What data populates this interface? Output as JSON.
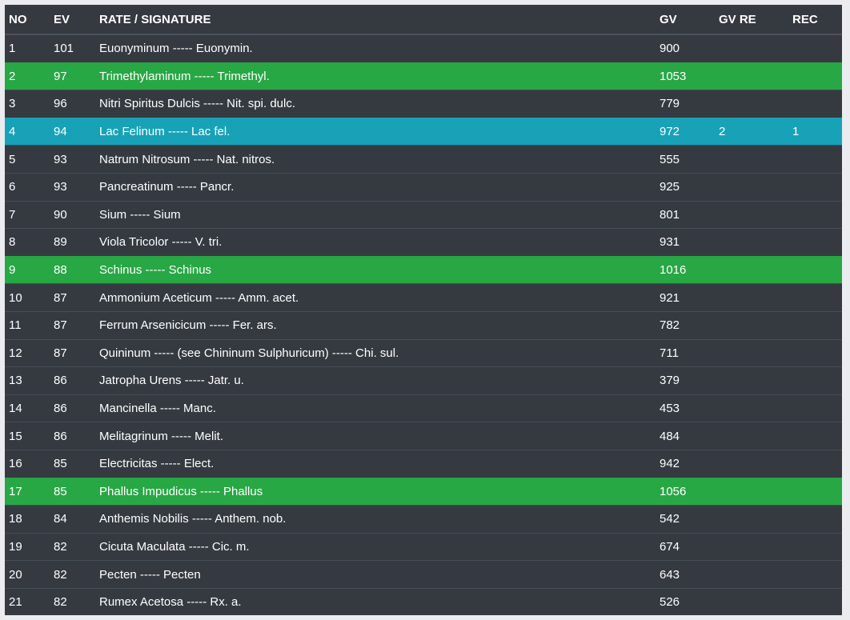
{
  "colors": {
    "background": "#343a40",
    "highlight_green": "#28a745",
    "highlight_cyan": "#17a2b8"
  },
  "table": {
    "headers": [
      "NO",
      "EV",
      "RATE / SIGNATURE",
      "GV",
      "GV RE",
      "REC"
    ],
    "rows": [
      {
        "no": "1",
        "ev": "101",
        "name": "Euonyminum ----- Euonymin.",
        "gv": "900",
        "gv_re": "",
        "rec": "",
        "highlight": ""
      },
      {
        "no": "2",
        "ev": "97",
        "name": "Trimethylaminum ----- Trimethyl.",
        "gv": "1053",
        "gv_re": "",
        "rec": "",
        "highlight": "green"
      },
      {
        "no": "3",
        "ev": "96",
        "name": "Nitri Spiritus Dulcis ----- Nit. spi. dulc.",
        "gv": "779",
        "gv_re": "",
        "rec": "",
        "highlight": ""
      },
      {
        "no": "4",
        "ev": "94",
        "name": "Lac Felinum ----- Lac fel.",
        "gv": "972",
        "gv_re": "2",
        "rec": "1",
        "highlight": "cyan"
      },
      {
        "no": "5",
        "ev": "93",
        "name": "Natrum Nitrosum ----- Nat. nitros.",
        "gv": "555",
        "gv_re": "",
        "rec": "",
        "highlight": ""
      },
      {
        "no": "6",
        "ev": "93",
        "name": "Pancreatinum ----- Pancr.",
        "gv": "925",
        "gv_re": "",
        "rec": "",
        "highlight": ""
      },
      {
        "no": "7",
        "ev": "90",
        "name": "Sium ----- Sium",
        "gv": "801",
        "gv_re": "",
        "rec": "",
        "highlight": ""
      },
      {
        "no": "8",
        "ev": "89",
        "name": "Viola Tricolor ----- V. tri.",
        "gv": "931",
        "gv_re": "",
        "rec": "",
        "highlight": ""
      },
      {
        "no": "9",
        "ev": "88",
        "name": "Schinus ----- Schinus",
        "gv": "1016",
        "gv_re": "",
        "rec": "",
        "highlight": "green"
      },
      {
        "no": "10",
        "ev": "87",
        "name": "Ammonium Aceticum ----- Amm. acet.",
        "gv": "921",
        "gv_re": "",
        "rec": "",
        "highlight": ""
      },
      {
        "no": "11",
        "ev": "87",
        "name": "Ferrum Arsenicicum ----- Fer. ars.",
        "gv": "782",
        "gv_re": "",
        "rec": "",
        "highlight": ""
      },
      {
        "no": "12",
        "ev": "87",
        "name": "Quininum ----- (see Chininum Sulphuricum) ----- Chi. sul.",
        "gv": "711",
        "gv_re": "",
        "rec": "",
        "highlight": ""
      },
      {
        "no": "13",
        "ev": "86",
        "name": "Jatropha Urens ----- Jatr. u.",
        "gv": "379",
        "gv_re": "",
        "rec": "",
        "highlight": ""
      },
      {
        "no": "14",
        "ev": "86",
        "name": "Mancinella ----- Manc.",
        "gv": "453",
        "gv_re": "",
        "rec": "",
        "highlight": ""
      },
      {
        "no": "15",
        "ev": "86",
        "name": "Melitagrinum ----- Melit.",
        "gv": "484",
        "gv_re": "",
        "rec": "",
        "highlight": ""
      },
      {
        "no": "16",
        "ev": "85",
        "name": "Electricitas ----- Elect.",
        "gv": "942",
        "gv_re": "",
        "rec": "",
        "highlight": ""
      },
      {
        "no": "17",
        "ev": "85",
        "name": "Phallus Impudicus ----- Phallus",
        "gv": "1056",
        "gv_re": "",
        "rec": "",
        "highlight": "green"
      },
      {
        "no": "18",
        "ev": "84",
        "name": "Anthemis Nobilis ----- Anthem. nob.",
        "gv": "542",
        "gv_re": "",
        "rec": "",
        "highlight": ""
      },
      {
        "no": "19",
        "ev": "82",
        "name": "Cicuta Maculata ----- Cic. m.",
        "gv": "674",
        "gv_re": "",
        "rec": "",
        "highlight": ""
      },
      {
        "no": "20",
        "ev": "82",
        "name": "Pecten ----- Pecten",
        "gv": "643",
        "gv_re": "",
        "rec": "",
        "highlight": ""
      },
      {
        "no": "21",
        "ev": "82",
        "name": "Rumex Acetosa ----- Rx. a.",
        "gv": "526",
        "gv_re": "",
        "rec": "",
        "highlight": ""
      }
    ]
  }
}
